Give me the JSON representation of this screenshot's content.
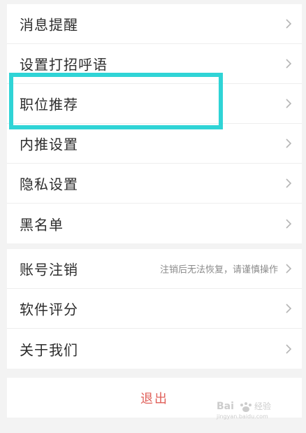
{
  "settings": {
    "group1": [
      {
        "label": "消息提醒"
      },
      {
        "label": "设置打招呼语"
      },
      {
        "label": "职位推荐"
      },
      {
        "label": "内推设置"
      },
      {
        "label": "隐私设置"
      },
      {
        "label": "黑名单"
      }
    ],
    "group2": [
      {
        "label": "账号注销",
        "hint": "注销后无法恢复，请谨慎操作"
      },
      {
        "label": "软件评分"
      },
      {
        "label": "关于我们"
      }
    ],
    "logout_label": "退出"
  },
  "highlight_color": "#2fd4d6",
  "logout_color": "#e0605a",
  "watermark": {
    "text": "Baidu 经验",
    "subtext": "jingyan.baidu.com"
  }
}
